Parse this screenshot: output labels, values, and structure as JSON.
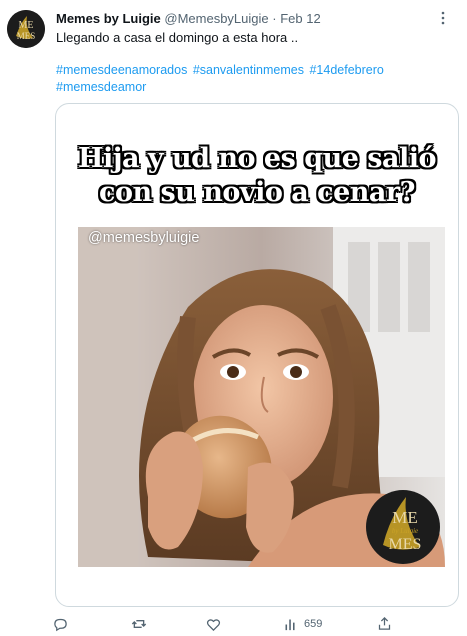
{
  "author": {
    "name": "Memes by Luigie",
    "handle": "@MemesbyLuigie",
    "separator": "·",
    "date": "Feb 12",
    "avatar_icon": "memes-logo-avatar"
  },
  "more_label": "⋮",
  "tweet_text": "Llegando a casa el domingo a esta hora ..",
  "hashtags": [
    "#memesdeenamorados",
    "#sanvalentinmemes",
    "#14defebrero",
    "#memesdeamor"
  ],
  "media": {
    "caption_line1": "Hija y ud no es que salió",
    "caption_line2": "con su novio a cenar?",
    "watermark": "@memesbyluigie",
    "logo_text_top": "ME",
    "logo_text_script": "by Luigie",
    "logo_text_bottom": "MES"
  },
  "actions": {
    "reply_icon": "reply-icon",
    "retweet_icon": "retweet-icon",
    "like_icon": "like-icon",
    "views_icon": "views-icon",
    "views_count": "659",
    "share_icon": "share-icon"
  },
  "colors": {
    "link": "#1d9bf0",
    "muted": "#536471",
    "text": "#0f1419",
    "border": "#cfd9de",
    "logo_gold": "#c9a227"
  }
}
